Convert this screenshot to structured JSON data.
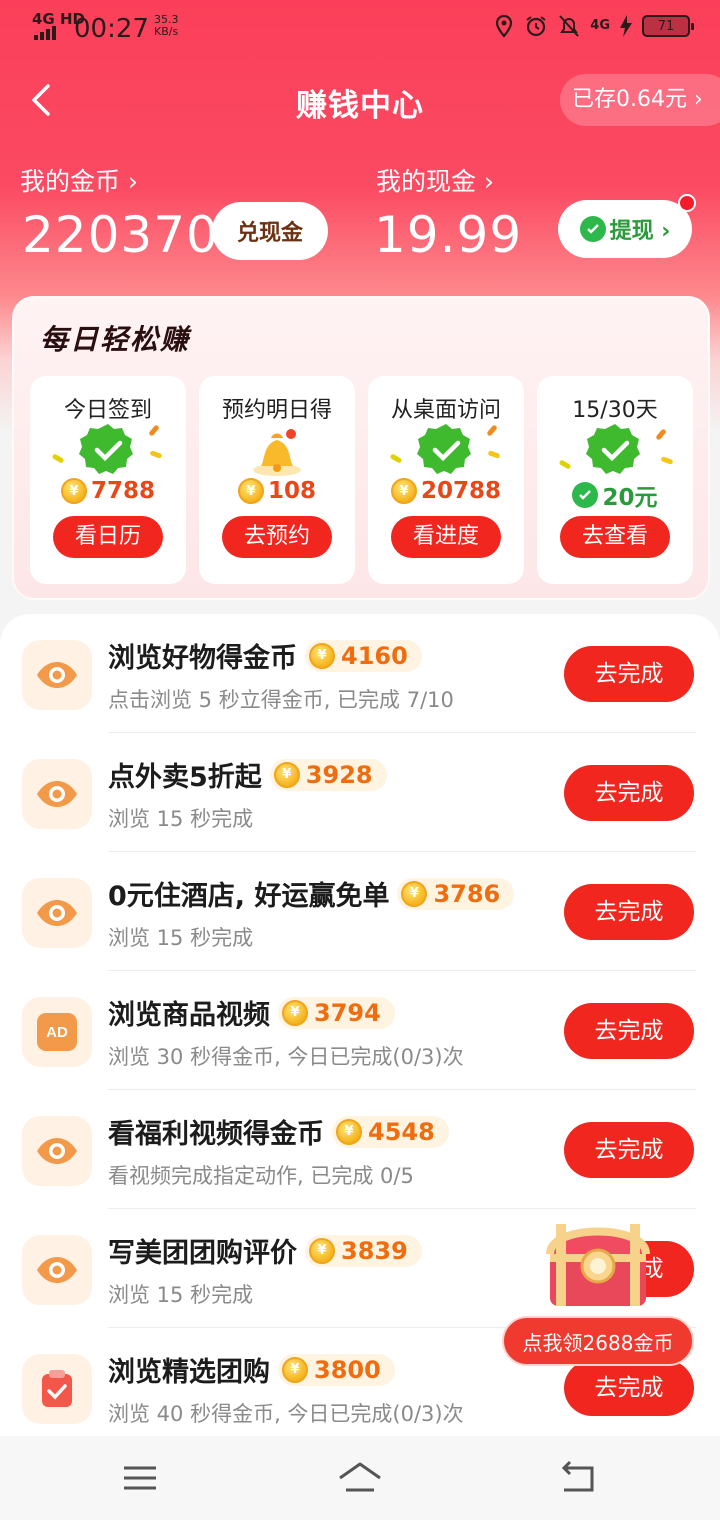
{
  "status_bar": {
    "network": "4G HD",
    "time": "00:27",
    "speed_value": "35.3",
    "speed_unit": "KB/s",
    "battery": "71",
    "network_right": "4G"
  },
  "header": {
    "title": "赚钱中心",
    "saved_label": "已存0.64元 ›"
  },
  "wallet": {
    "coins_label": "我的金币 ›",
    "coins_value": "220370",
    "exchange_button": "兑现金",
    "cash_label": "我的现金 ›",
    "cash_value": "19.99",
    "withdraw_button": "提现 ›"
  },
  "daily": {
    "title": "每日轻松赚",
    "cards": [
      {
        "title": "今日签到",
        "reward": "7788",
        "button": "看日历",
        "icon": "check-badge-icon"
      },
      {
        "title": "预约明日得",
        "reward": "108",
        "button": "去预约",
        "icon": "bell-icon"
      },
      {
        "title": "从桌面访问",
        "reward": "20788",
        "button": "看进度",
        "icon": "check-badge-icon"
      },
      {
        "title": "15/30天",
        "reward": "20元",
        "button": "去查看",
        "icon": "check-badge-icon"
      }
    ]
  },
  "tasks": [
    {
      "name": "浏览好物得金币",
      "points": "4160",
      "desc": "点击浏览 5 秒立得金币, 已完成 7/10",
      "button": "去完成",
      "icon": "eye-icon"
    },
    {
      "name": "点外卖5折起",
      "points": "3928",
      "desc": "浏览 15 秒完成",
      "button": "去完成",
      "icon": "eye-icon"
    },
    {
      "name": "0元住酒店, 好运赢免单",
      "points": "3786",
      "desc": "浏览 15 秒完成",
      "button": "去完成",
      "icon": "eye-icon"
    },
    {
      "name": "浏览商品视频",
      "points": "3794",
      "desc": "浏览 30 秒得金币, 今日已完成(0/3)次",
      "button": "去完成",
      "icon": "ad-icon"
    },
    {
      "name": "看福利视频得金币",
      "points": "4548",
      "desc": "看视频完成指定动作, 已完成 0/5",
      "button": "去完成",
      "icon": "eye-icon"
    },
    {
      "name": "写美团团购评价",
      "points": "3839",
      "desc": "浏览 15 秒完成",
      "button": "去完成",
      "icon": "eye-icon"
    },
    {
      "name": "浏览精选团购",
      "points": "3800",
      "desc": "浏览 40 秒得金币, 今日已完成(0/3)次",
      "button": "去完成",
      "icon": "clipboard-check-icon"
    }
  ],
  "coin_symbol": "¥",
  "chest": {
    "label": "点我领2688金币",
    "icon": "treasure-chest-icon"
  },
  "colors": {
    "accent_red": "#f0261f",
    "header_red": "#fb3f5a",
    "points_orange": "#ef6d0f",
    "wechat_green": "#2cb84a"
  }
}
